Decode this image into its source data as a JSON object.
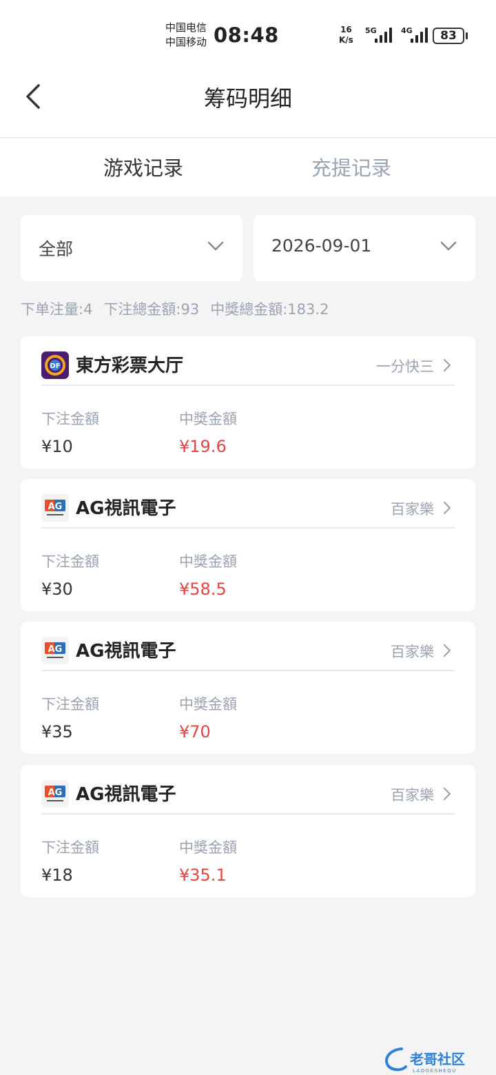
{
  "status_bar": {
    "carrier1": "中国电信",
    "carrier2": "中国移动",
    "time": "08:48",
    "speed_value": "16",
    "speed_unit": "K/s",
    "sig1_label": "5G",
    "sig2_label": "4G",
    "battery": "83"
  },
  "header": {
    "title": "筹码明细"
  },
  "tabs": [
    {
      "label": "游戏记录",
      "active": true
    },
    {
      "label": "充提记录",
      "active": false
    }
  ],
  "filters": {
    "category": "全部",
    "date": "2026-09-01"
  },
  "summary": {
    "order_count": "下单注量:4",
    "total_bet": "下注總金額:93",
    "total_win": "中獎總金額:183.2"
  },
  "labels": {
    "bet": "下注金額",
    "win": "中獎金額"
  },
  "records": [
    {
      "platform": "東方彩票大厅",
      "logo": "df-logo-icon",
      "game": "一分快三",
      "bet": "¥10",
      "win": "¥19.6"
    },
    {
      "platform": "AG視訊電子",
      "logo": "ag-logo-icon",
      "game": "百家樂",
      "bet": "¥30",
      "win": "¥58.5"
    },
    {
      "platform": "AG視訊電子",
      "logo": "ag-logo-icon",
      "game": "百家樂",
      "bet": "¥35",
      "win": "¥70"
    },
    {
      "platform": "AG視訊電子",
      "logo": "ag-logo-icon",
      "game": "百家樂",
      "bet": "¥18",
      "win": "¥35.1"
    }
  ],
  "watermark": {
    "text": "老哥社区",
    "sub": "LAOGESHEQU"
  },
  "colors": {
    "win": "#e2463e",
    "muted": "#9aa3b2",
    "background": "#f4f4f5"
  }
}
